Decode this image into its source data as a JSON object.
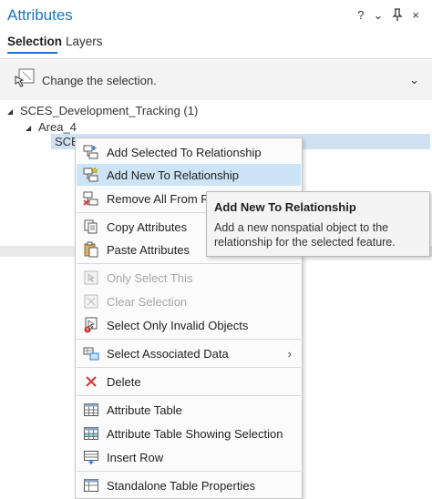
{
  "pane": {
    "title": "Attributes",
    "controls": {
      "help": "?",
      "menu": "⌄",
      "pin": "⊥",
      "close": "×"
    }
  },
  "tabs": [
    {
      "label": "Selection",
      "active": true
    },
    {
      "label": "Layers",
      "active": false
    }
  ],
  "selection_band": {
    "text": "Change the selection.",
    "chevron": "⌄"
  },
  "tree": {
    "root": "SCES_Development_Tracking (1)",
    "child": "Area_4",
    "selected": "SCE"
  },
  "context_menu": {
    "items": [
      {
        "label": "Add Selected To Relationship",
        "icon": "add-selected-relationship-icon",
        "state": "normal"
      },
      {
        "label": "Add New To Relationship",
        "icon": "add-new-relationship-icon",
        "state": "hover"
      },
      {
        "label": "Remove All From Rel",
        "icon": "remove-all-relationship-icon",
        "state": "normal"
      },
      {
        "label": "Copy Attributes",
        "icon": "copy-icon",
        "state": "normal"
      },
      {
        "label": "Paste Attributes",
        "icon": "paste-icon",
        "state": "normal"
      },
      {
        "label": "Only Select This",
        "icon": "select-this-icon",
        "state": "disabled"
      },
      {
        "label": "Clear Selection",
        "icon": "clear-selection-icon",
        "state": "disabled"
      },
      {
        "label": "Select Only Invalid Objects",
        "icon": "invalid-objects-icon",
        "state": "normal"
      },
      {
        "label": "Select Associated Data",
        "icon": "associated-data-icon",
        "state": "normal",
        "submenu": "›"
      },
      {
        "label": "Delete",
        "icon": "delete-icon",
        "state": "normal"
      },
      {
        "label": "Attribute Table",
        "icon": "table-icon",
        "state": "normal"
      },
      {
        "label": "Attribute Table Showing Selection",
        "icon": "table-selection-icon",
        "state": "normal"
      },
      {
        "label": "Insert Row",
        "icon": "insert-row-icon",
        "state": "normal"
      },
      {
        "label": "Standalone Table Properties",
        "icon": "table-properties-icon",
        "state": "normal"
      }
    ]
  },
  "tooltip": {
    "title": "Add New To Relationship",
    "body": "Add a new nonspatial object to the relationship for the selected feature."
  },
  "colors": {
    "accent": "#1b75c8",
    "hover": "#cde4f7",
    "selected_row": "#cfe2f3",
    "delete_red": "#d13438"
  }
}
